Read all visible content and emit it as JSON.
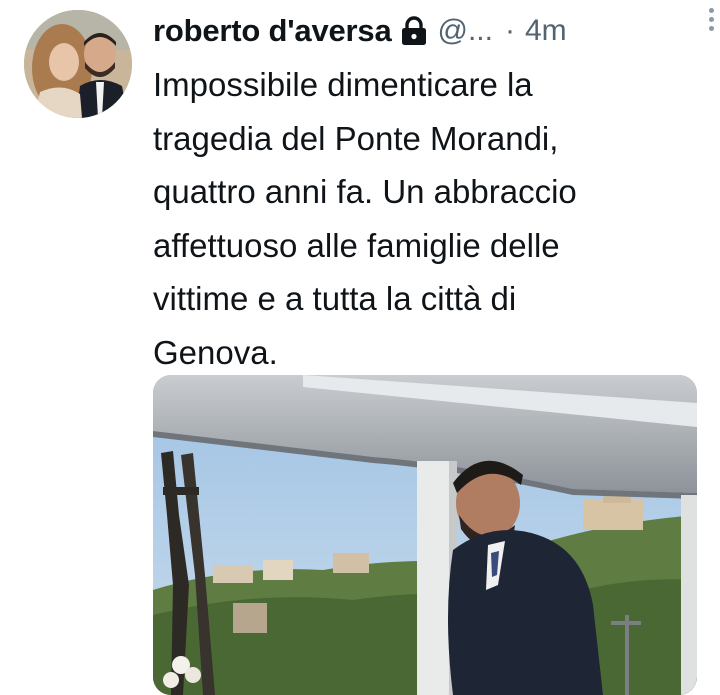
{
  "tweet": {
    "author_name": "roberto d'aversa",
    "handle": "@...",
    "separator": "·",
    "time": "4m",
    "text": "Impossibile dimenticare la\ntragedia del Ponte Morandi,\nquattro anni fa. Un abbraccio\naffettuoso alle famiglie delle\nvittime e a tutta la città di\nGenova.",
    "icons": {
      "protected": "lock-icon",
      "more": "more-vertical-icon",
      "avatar": "avatar-photo"
    }
  },
  "colors": {
    "text_primary": "#0f1419",
    "text_secondary": "#536471",
    "background": "#ffffff"
  }
}
